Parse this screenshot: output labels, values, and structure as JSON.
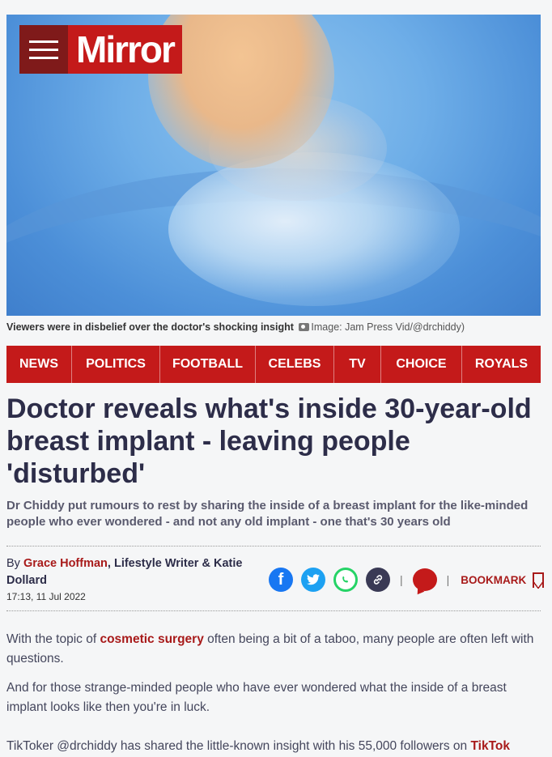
{
  "header": {
    "logo_text": "Mirror",
    "menu_icon": "hamburger-icon"
  },
  "hero": {
    "caption_text": "Viewers were in disbelief over the doctor's shocking insight",
    "credit_text": "Image: Jam Press Vid/@drchiddy",
    "credit_icon": "camera-icon"
  },
  "nav": {
    "items": [
      "NEWS",
      "POLITICS",
      "FOOTBALL",
      "CELEBS",
      "TV",
      "CHOICE",
      "ROYALS"
    ]
  },
  "article": {
    "headline": "Doctor reveals what's inside 30-year-old breast implant - leaving people 'disturbed'",
    "standfirst": "Dr Chiddy put rumours to rest by sharing the inside of a breast implant for the like-minded people who ever wondered - and not any old implant - one that's 30 years old",
    "byline": {
      "by": "By",
      "author1": "Grace Hoffman",
      "author1_role": ", Lifestyle Writer &",
      "author2": "Katie Dollard"
    },
    "dateline": "17:13, 11 Jul 2022",
    "bookmark_label": "BOOKMARK",
    "share_icons": [
      "facebook-icon",
      "twitter-icon",
      "whatsapp-icon",
      "link-icon",
      "comment-icon"
    ],
    "paragraphs": {
      "p1_before": "With the topic of ",
      "p1_link": "cosmetic surgery",
      "p1_after": " often being a bit of a taboo, many people are often left with questions.",
      "p2": "And for those strange-minded people who have ever wondered what the inside of a breast implant looks like then you're in luck.",
      "p3_before": "TikToker @drchiddy has shared the little-known insight with his 55,000 followers on ",
      "p3_link": "TikTok"
    }
  },
  "colors": {
    "brand_red": "#c41a1a",
    "menu_dark_red": "#7f1a1a",
    "headline": "#2d2d49",
    "link_red": "#a81a1a"
  }
}
